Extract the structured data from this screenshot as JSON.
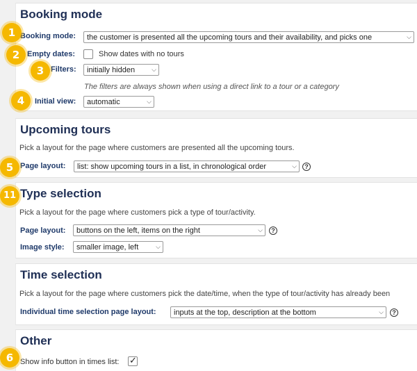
{
  "booking": {
    "title": "Booking mode",
    "booking_mode_label": "Booking mode:",
    "booking_mode_value": "the customer is presented all the upcoming tours and their availability, and picks one",
    "empty_dates_label": "Empty dates:",
    "empty_dates_option": "Show dates with no tours",
    "filters_label": "Filters:",
    "filters_value": "initially hidden",
    "filters_note": "The filters are always shown when using a direct link to a tour or a category",
    "initial_view_label": "Initial view:",
    "initial_view_value": "automatic"
  },
  "upcoming": {
    "title": "Upcoming tours",
    "desc": "Pick a layout for the page where customers are presented all the upcoming tours.",
    "layout_label": "Page layout:",
    "layout_value": "list: show upcoming tours in a list, in chronological order"
  },
  "type_selection": {
    "title": "Type selection",
    "desc": "Pick a layout for the page where customers pick a type of tour/activity.",
    "layout_label": "Page layout:",
    "layout_value": "buttons on the left, items on the right",
    "image_label": "Image style:",
    "image_value": "smaller image, left"
  },
  "time_selection": {
    "title": "Time selection",
    "desc": "Pick a layout for the page where customers pick the date/time, when the type of tour/activity has already been",
    "layout_label": "Individual time selection page layout:",
    "layout_value": "inputs at the top, description at the bottom"
  },
  "other": {
    "title": "Other",
    "info_button_label": "Show info button in times list:",
    "info_button_checked": true
  },
  "badges": [
    "1",
    "2",
    "3",
    "4",
    "5",
    "11",
    "6"
  ],
  "help_glyph": "?",
  "icons": {
    "chevron": "chevron-down-icon",
    "help": "help-icon",
    "check": "checkmark-icon"
  },
  "colors": {
    "badge": "#f5b800",
    "heading": "#1f2f55",
    "label": "#1f3a6a"
  }
}
